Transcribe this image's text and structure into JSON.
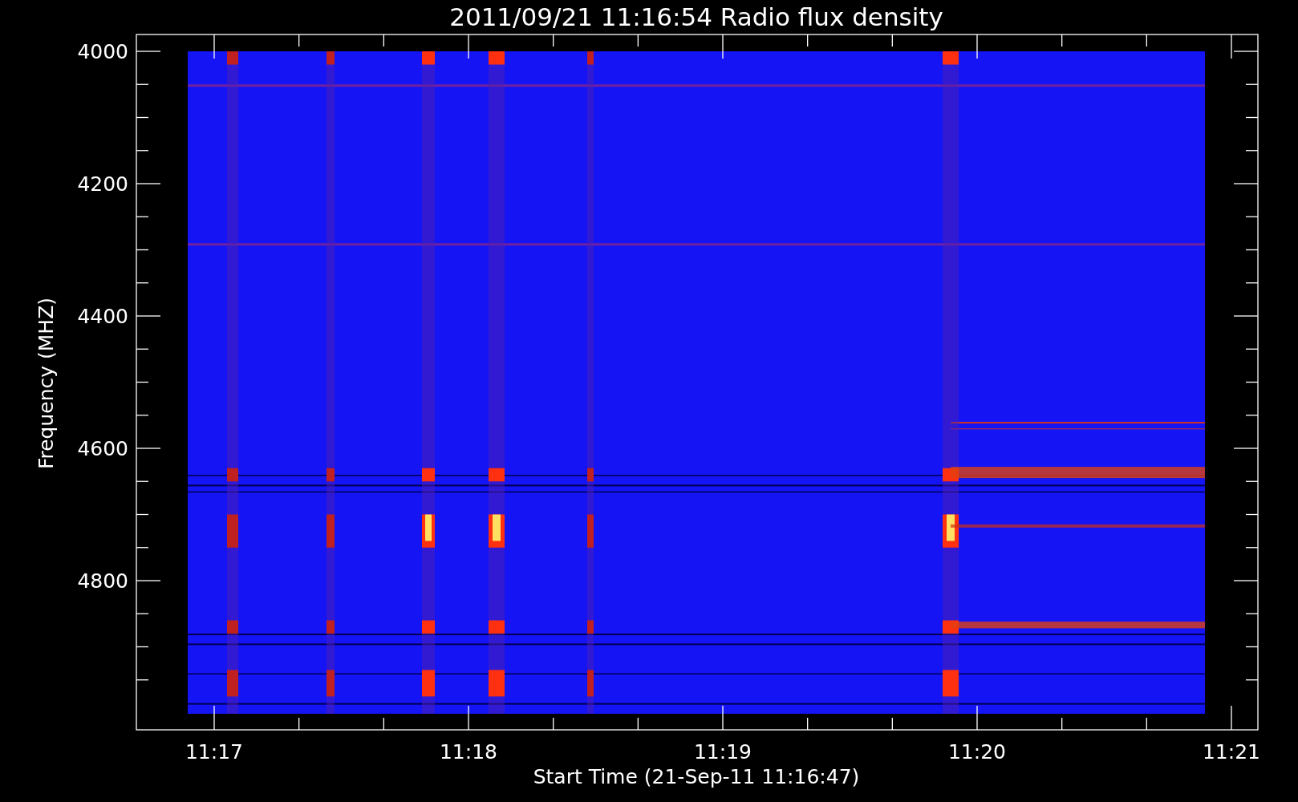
{
  "title": "2011/09/21 11:16:54 Radio flux density",
  "y_axis": {
    "label": "Frequency (MHZ)",
    "ticks": [
      "4000",
      "4200",
      "4400",
      "4600",
      "4800"
    ]
  },
  "x_axis": {
    "label": "Start Time (21-Sep-11 11:16:47)",
    "ticks": [
      "11:17",
      "11:18",
      "11:19",
      "11:20",
      "11:21"
    ]
  }
}
